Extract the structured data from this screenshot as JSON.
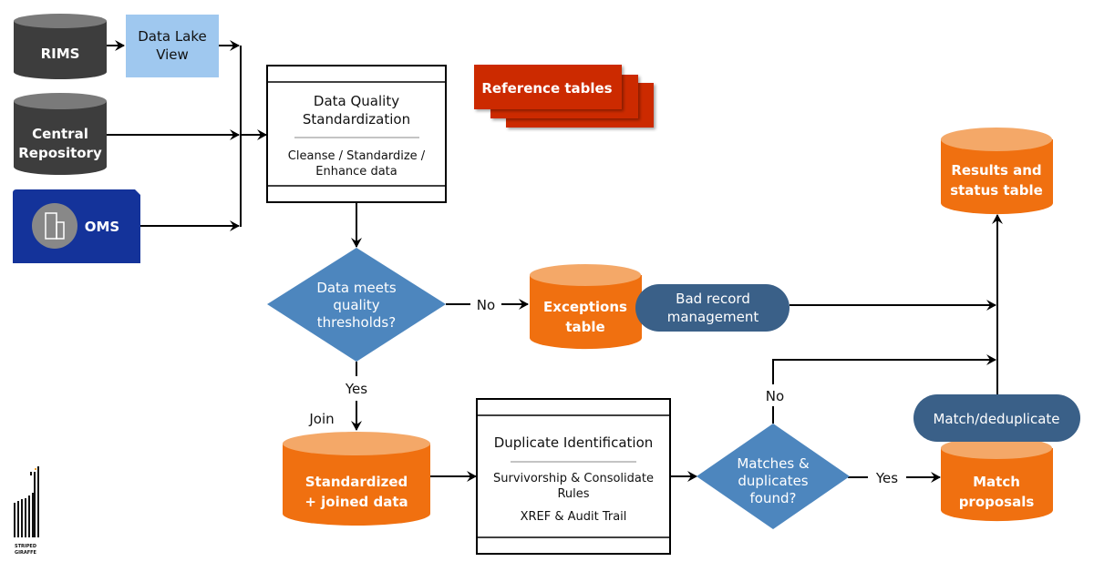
{
  "colors": {
    "dark_cylinder": "#3d3d3d",
    "data_lake": "#9fc8ef",
    "oms": "#14339a",
    "diamond": "#4d86be",
    "orange": "#f07010",
    "orange_top": "#f4a868",
    "pill": "#3a6088",
    "reference": "#cc2a00"
  },
  "sources": {
    "rims": "RIMS",
    "central": [
      "Central",
      "Repository"
    ],
    "oms": "OMS",
    "oms_icon": "building-icon",
    "data_lake": [
      "Data Lake",
      "View"
    ]
  },
  "dq_box": {
    "title": [
      "Data Quality",
      "Standardization"
    ],
    "sub": [
      "Cleanse / Standardize /",
      "Enhance data"
    ]
  },
  "reference_tables": "Reference tables",
  "decision1": {
    "lines": [
      "Data meets",
      "quality",
      "thresholds?"
    ],
    "no": "No",
    "yes": "Yes"
  },
  "exceptions": [
    "Exceptions",
    "table"
  ],
  "bad_record": [
    "Bad record",
    "management"
  ],
  "results": [
    "Results and",
    "status table"
  ],
  "join": "Join",
  "standardized": [
    "Standardized",
    "+ joined data"
  ],
  "dup_box": {
    "title": "Duplicate Identification",
    "sub": [
      "Survivorship & Consolidate",
      "Rules"
    ],
    "sub2": "XREF & Audit Trail"
  },
  "decision2": {
    "lines": [
      "Matches &",
      "duplicates",
      "found?"
    ],
    "no": "No",
    "yes": "Yes"
  },
  "match_dedup": "Match/deduplicate",
  "match_proposals": [
    "Match",
    "proposals"
  ],
  "logo": {
    "text": [
      "STRIPED",
      "GIRAFFE"
    ]
  }
}
